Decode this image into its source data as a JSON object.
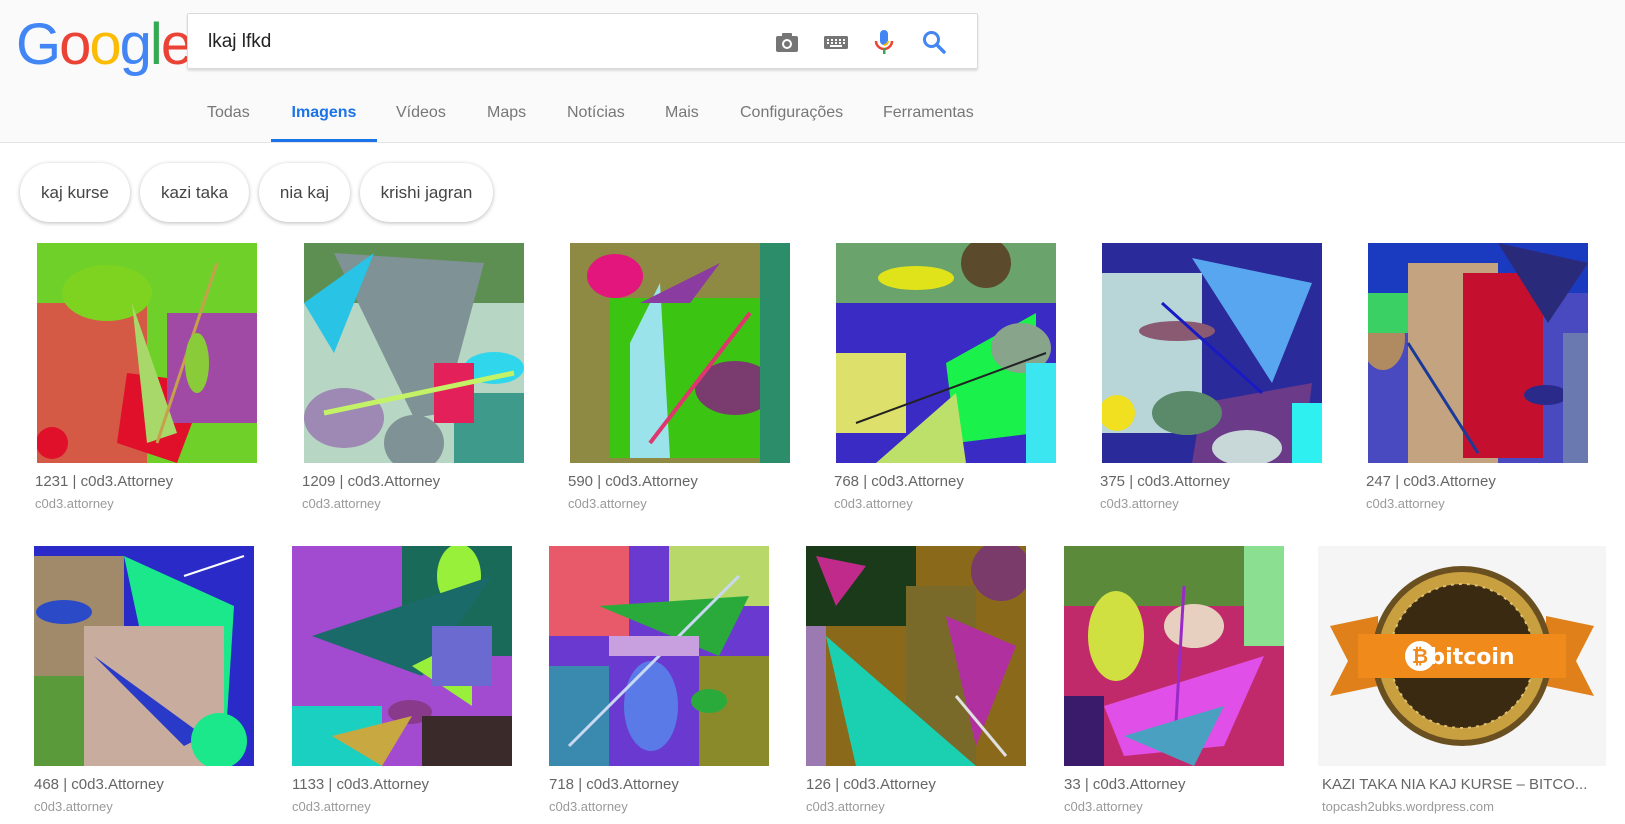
{
  "logo": {
    "letters": [
      "G",
      "o",
      "o",
      "g",
      "l",
      "e"
    ],
    "colors": [
      "#4285f4",
      "#ea4335",
      "#fbbc05",
      "#4285f4",
      "#34a853",
      "#ea4335"
    ]
  },
  "search": {
    "value": "lkaj lfkd"
  },
  "tabs": [
    {
      "label": "Todas"
    },
    {
      "label": "Imagens",
      "active": true
    },
    {
      "label": "Vídeos"
    },
    {
      "label": "Maps"
    },
    {
      "label": "Notícias"
    },
    {
      "label": "Mais"
    },
    {
      "label": "Configurações"
    },
    {
      "label": "Ferramentas"
    }
  ],
  "chips": [
    "kaj kurse",
    "kazi taka",
    "nia kaj",
    "krishi jagran"
  ],
  "results": [
    {
      "title": "1231 | c0d3.Attorney",
      "source": "c0d3.attorney"
    },
    {
      "title": "1209 | c0d3.Attorney",
      "source": "c0d3.attorney"
    },
    {
      "title": "590 | c0d3.Attorney",
      "source": "c0d3.attorney"
    },
    {
      "title": "768 | c0d3.Attorney",
      "source": "c0d3.attorney"
    },
    {
      "title": "375 | c0d3.Attorney",
      "source": "c0d3.attorney"
    },
    {
      "title": "247 | c0d3.Attorney",
      "source": "c0d3.attorney"
    },
    {
      "title": "468 | c0d3.Attorney",
      "source": "c0d3.attorney"
    },
    {
      "title": "1133 | c0d3.Attorney",
      "source": "c0d3.attorney"
    },
    {
      "title": "718 | c0d3.Attorney",
      "source": "c0d3.attorney"
    },
    {
      "title": "126 | c0d3.Attorney",
      "source": "c0d3.attorney"
    },
    {
      "title": "33 | c0d3.Attorney",
      "source": "c0d3.attorney"
    },
    {
      "title": "KAZI TAKA NIA KAJ KURSE – BITCO...",
      "source": "topcash2ubks.wordpress.com",
      "image_text": "bitcoin"
    }
  ],
  "icons": {
    "camera": "camera-icon",
    "keyboard": "keyboard-icon",
    "mic": "microphone-icon",
    "search": "search-icon"
  },
  "colors": {
    "accent": "#1a73e8"
  }
}
